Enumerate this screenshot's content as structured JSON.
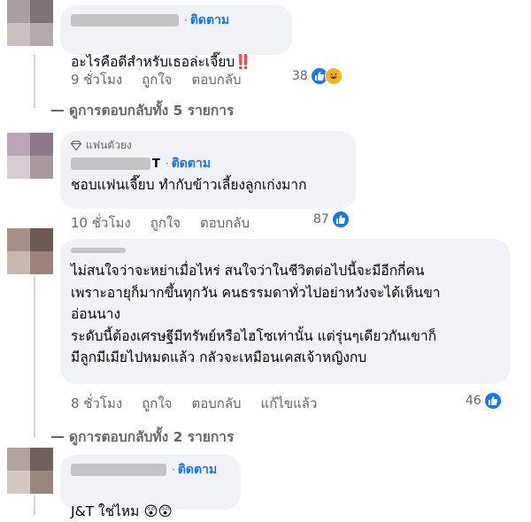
{
  "comments": [
    {
      "follow": "ติดตาม",
      "text": "อะไรคือดีสำหรับเธอล่ะเจี๊ยบ",
      "emoji_suffix": "‼️",
      "time": "9 ชั่วโมง",
      "like": "ถูกใจ",
      "reply": "ตอบกลับ",
      "reaction_count": "38",
      "reactions": [
        "like-icon",
        "haha-icon"
      ]
    },
    {
      "fan_badge": "แฟนตัวยง",
      "name_fragment": "T",
      "follow": "ติดตาม",
      "text": "ชอบแฟนเจี๊ยบ ทำกับข้าวเลี้ยงลูกเก่งมาก",
      "time": "10 ชั่วโมง",
      "like": "ถูกใจ",
      "reply": "ตอบกลับ",
      "reaction_count": "87",
      "reactions": [
        "like-icon"
      ]
    },
    {
      "text": "ไม่สนใจว่าจะหย่าเมื่อไหร่ สนใจว่าในชีวิตต่อไปนี้จะมีอีกกี่คน\nเพราะอายุก็มากขึ้นทุกวัน คนธรรมดาทั่วไปอย่าหวังจะได้เห็นขา\nอ่อนนาง\nระดับนี้ต้องเศรษฐีมีทรัพย์หรือไฮโซเท่านั้น แต่รุ่นๆเดียวกันเขาก็\nมีลูกมีเมียไปหมดแล้ว กลัวจะเหมือนเคสเจ้าหญิงกบ",
      "time": "8 ชั่วโมง",
      "like": "ถูกใจ",
      "reply": "ตอบกลับ",
      "edited": "แก้ไขแล้ว",
      "reaction_count": "46",
      "reactions": [
        "like-icon"
      ]
    },
    {
      "follow": "ติดตาม",
      "text": "J&T ใช่ไหม",
      "emoji_suffix": "😲😲"
    }
  ],
  "view_replies": [
    "ดูการตอบกลับทั้ง 5 รายการ",
    "ดูการตอบกลับทั้ง 2 รายการ"
  ],
  "colors": {
    "bubble": "#f0f2f5",
    "link_blue": "#1b74e4",
    "meta_gray": "#65676b",
    "like_blue": "#1877f2"
  }
}
